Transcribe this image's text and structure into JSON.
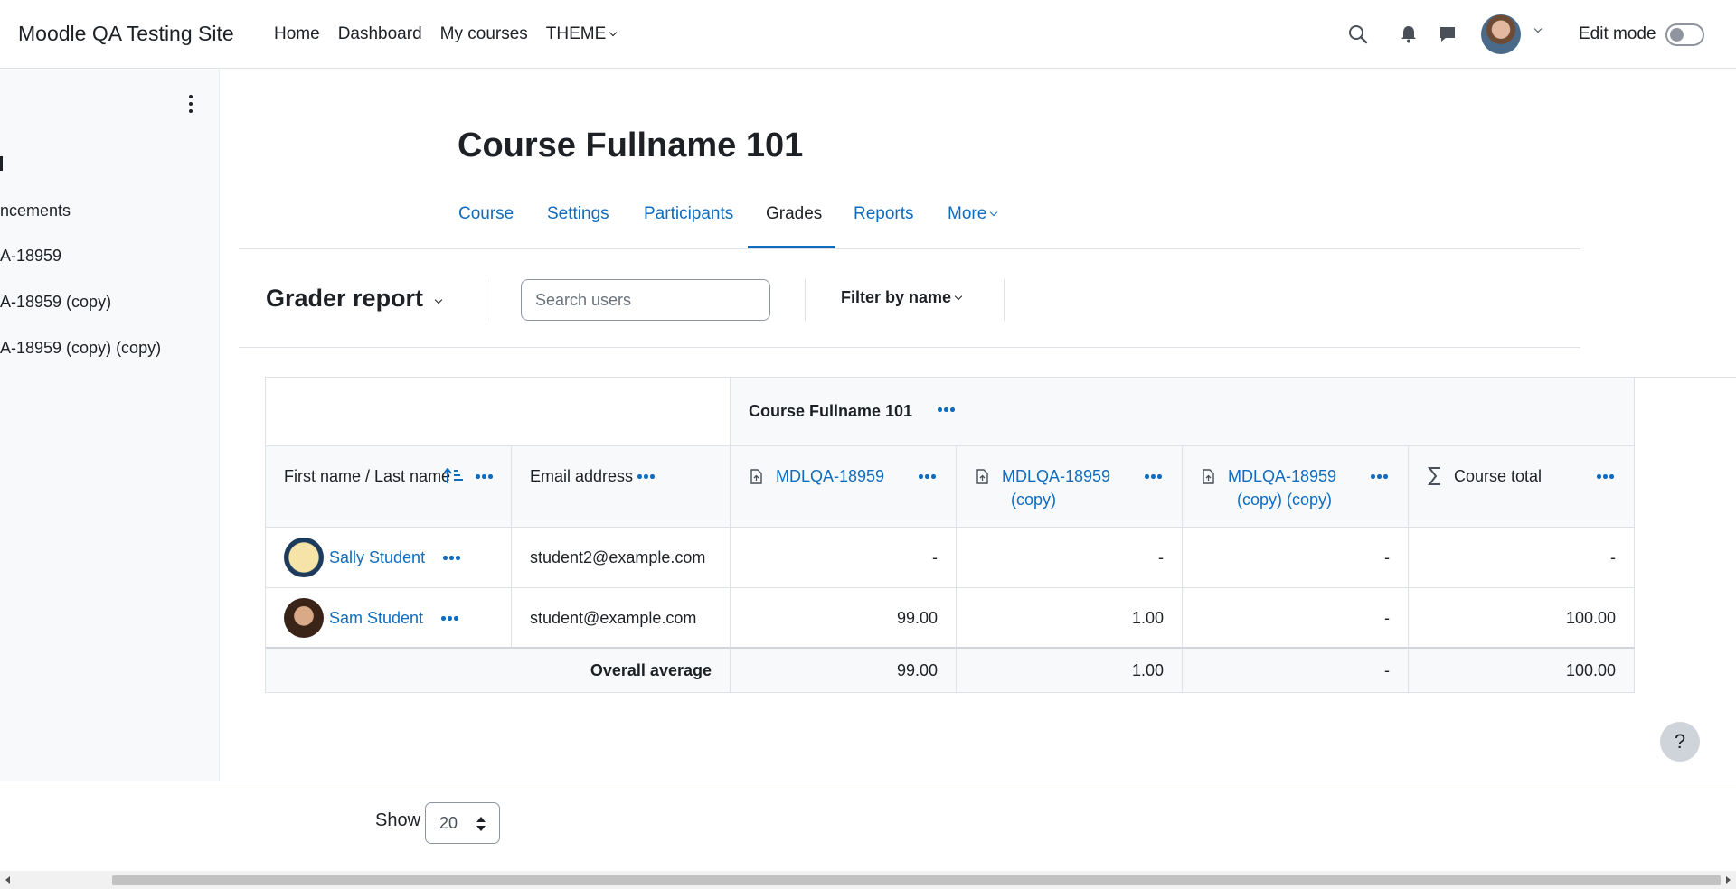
{
  "navbar": {
    "site_name": "Moodle QA Testing Site",
    "links": [
      "Home",
      "Dashboard",
      "My courses",
      "THEME"
    ],
    "icons": [
      "search-icon",
      "bell-icon",
      "chat-icon"
    ],
    "edit_mode_label": "Edit mode",
    "edit_mode_on": false
  },
  "drawer": {
    "items": [
      "ncements",
      "A-18959",
      "A-18959 (copy)",
      "A-18959 (copy) (copy)"
    ]
  },
  "course": {
    "title": "Course Fullname 101",
    "tabs": [
      "Course",
      "Settings",
      "Participants",
      "Grades",
      "Reports",
      "More"
    ],
    "active_tab": "Grades"
  },
  "action_bar": {
    "report_title": "Grader report",
    "search_placeholder": "Search users",
    "filter_label": "Filter by name"
  },
  "grader_table": {
    "category_header": "Course Fullname 101",
    "columns": {
      "name": "First name / Last name",
      "email": "Email address",
      "item1": "MDLQA-18959",
      "item2_line1": "MDLQA-18959",
      "item2_line2": "(copy)",
      "item3_line1": "MDLQA-18959",
      "item3_line2": "(copy) (copy)",
      "total": "Course total"
    },
    "rows": [
      {
        "name": "Sally Student",
        "email": "student2@example.com",
        "g1": "-",
        "g2": "-",
        "g3": "-",
        "total": "-"
      },
      {
        "name": "Sam Student",
        "email": "student@example.com",
        "g1": "99.00",
        "g2": "1.00",
        "g3": "-",
        "total": "100.00"
      }
    ],
    "average": {
      "label": "Overall average",
      "g1": "99.00",
      "g2": "1.00",
      "g3": "-",
      "total": "100.00"
    }
  },
  "footer": {
    "show_label": "Show",
    "per_page": "20"
  },
  "help_label": "?",
  "colors": {
    "link": "#0f6cbf",
    "text": "#1d2125",
    "border": "#dee2e6",
    "header_bg": "#f8f9fa"
  }
}
